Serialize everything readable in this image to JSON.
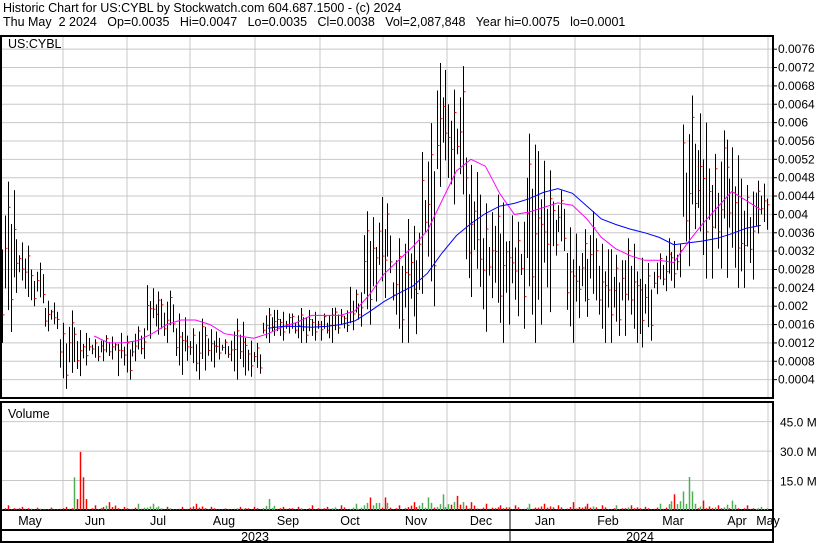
{
  "header": {
    "title": "Historic Chart for US:CYBL by Stockwatch.com 604.687.1500 - (c) 2024",
    "quote": "Thu May  2 2024   Op=0.0035   Hi=0.0047   Lo=0.0035   Cl=0.0038   Vol=2,087,848   Year hi=0.0075   lo=0.0001"
  },
  "chart_data": {
    "type": "ohlc",
    "symbol_label": "US:CYBL",
    "volume_label": "Volume",
    "price_ticks": [
      "0.0004",
      "0.0008",
      "0.0012",
      "0.0016",
      "0.002",
      "0.0024",
      "0.0028",
      "0.0032",
      "0.0036",
      "0.004",
      "0.0044",
      "0.0048",
      "0.0052",
      "0.0056",
      "0.006",
      "0.0064",
      "0.0068",
      "0.0072",
      "0.0076"
    ],
    "price_range": [
      0,
      0.0078
    ],
    "volume_ticks": [
      "15.0 M",
      "30.0 M",
      "45.0 M"
    ],
    "volume_range": [
      0,
      55
    ],
    "months": [
      "May",
      "Jun",
      "Jul",
      "Aug",
      "Sep",
      "Oct",
      "Nov",
      "Dec",
      "Jan",
      "Feb",
      "Mar",
      "Apr",
      "May"
    ],
    "years": [
      "2023",
      "2024"
    ],
    "colors": {
      "up": "#ff0000",
      "bar": "#000000",
      "ma_short": "#ff00ff",
      "ma_long": "#0000ff",
      "vol_up": "#4caf50",
      "vol_down": "#ff0000",
      "vol_flat": "#a0a0a0",
      "grid": "#c8c8c8"
    },
    "weekly": [
      [
        0.0049,
        0.0012,
        0.0044,
        3
      ],
      [
        0.0036,
        0.0022,
        0.0026,
        2
      ],
      [
        0.003,
        0.002,
        0.0024,
        1.5
      ],
      [
        0.0022,
        0.0014,
        0.0018,
        1.5
      ],
      [
        0.002,
        0.0002,
        0.0012,
        2
      ],
      [
        0.0016,
        0.0004,
        0.0012,
        37
      ],
      [
        0.0014,
        0.0008,
        0.0012,
        3
      ],
      [
        0.0014,
        0.0008,
        0.0012,
        5
      ],
      [
        0.0016,
        0.0004,
        0.0012,
        2
      ],
      [
        0.0016,
        0.0008,
        0.0014,
        4
      ],
      [
        0.0026,
        0.0012,
        0.0018,
        4
      ],
      [
        0.0024,
        0.0012,
        0.002,
        2
      ],
      [
        0.002,
        0.0004,
        0.0016,
        2
      ],
      [
        0.0018,
        0.0004,
        0.0014,
        4
      ],
      [
        0.0016,
        0.0006,
        0.0014,
        2
      ],
      [
        0.0014,
        0.0008,
        0.0012,
        1
      ],
      [
        0.0018,
        0.0004,
        0.0014,
        2
      ],
      [
        0.0014,
        0.0004,
        0.0012,
        2
      ],
      [
        0.002,
        0.0012,
        0.0018,
        7
      ],
      [
        0.002,
        0.0012,
        0.0018,
        2
      ],
      [
        0.002,
        0.0012,
        0.0018,
        2
      ],
      [
        0.002,
        0.0012,
        0.0018,
        3
      ],
      [
        0.002,
        0.0012,
        0.0018,
        2
      ],
      [
        0.002,
        0.0014,
        0.0018,
        3
      ],
      [
        0.0026,
        0.0014,
        0.0022,
        4
      ],
      [
        0.0042,
        0.0016,
        0.0032,
        8
      ],
      [
        0.0048,
        0.002,
        0.0036,
        8
      ],
      [
        0.0036,
        0.0012,
        0.003,
        3
      ],
      [
        0.0042,
        0.0012,
        0.0034,
        5
      ],
      [
        0.0062,
        0.002,
        0.0046,
        8
      ],
      [
        0.0076,
        0.0046,
        0.0062,
        10
      ],
      [
        0.0074,
        0.004,
        0.0056,
        9
      ],
      [
        0.0054,
        0.0022,
        0.0044,
        5
      ],
      [
        0.005,
        0.0012,
        0.004,
        4
      ],
      [
        0.0046,
        0.0012,
        0.0038,
        3
      ],
      [
        0.0044,
        0.0016,
        0.0038,
        3
      ],
      [
        0.006,
        0.0012,
        0.0046,
        4
      ],
      [
        0.0058,
        0.0016,
        0.0044,
        4
      ],
      [
        0.0046,
        0.003,
        0.0042,
        3
      ],
      [
        0.004,
        0.0012,
        0.0036,
        5
      ],
      [
        0.0042,
        0.0016,
        0.0034,
        4
      ],
      [
        0.0036,
        0.0012,
        0.0028,
        3
      ],
      [
        0.0036,
        0.0012,
        0.0032,
        3
      ],
      [
        0.0036,
        0.0012,
        0.003,
        3
      ],
      [
        0.0034,
        0.0011,
        0.003,
        2
      ],
      [
        0.0032,
        0.0022,
        0.0028,
        4
      ],
      [
        0.0036,
        0.0024,
        0.003,
        10
      ],
      [
        0.0068,
        0.0026,
        0.0048,
        21
      ],
      [
        0.0066,
        0.0026,
        0.0046,
        6
      ],
      [
        0.006,
        0.0026,
        0.0042,
        3
      ],
      [
        0.0058,
        0.0024,
        0.0044,
        6
      ],
      [
        0.0052,
        0.0024,
        0.004,
        3
      ],
      [
        0.0048,
        0.0035,
        0.0038,
        2
      ]
    ]
  }
}
